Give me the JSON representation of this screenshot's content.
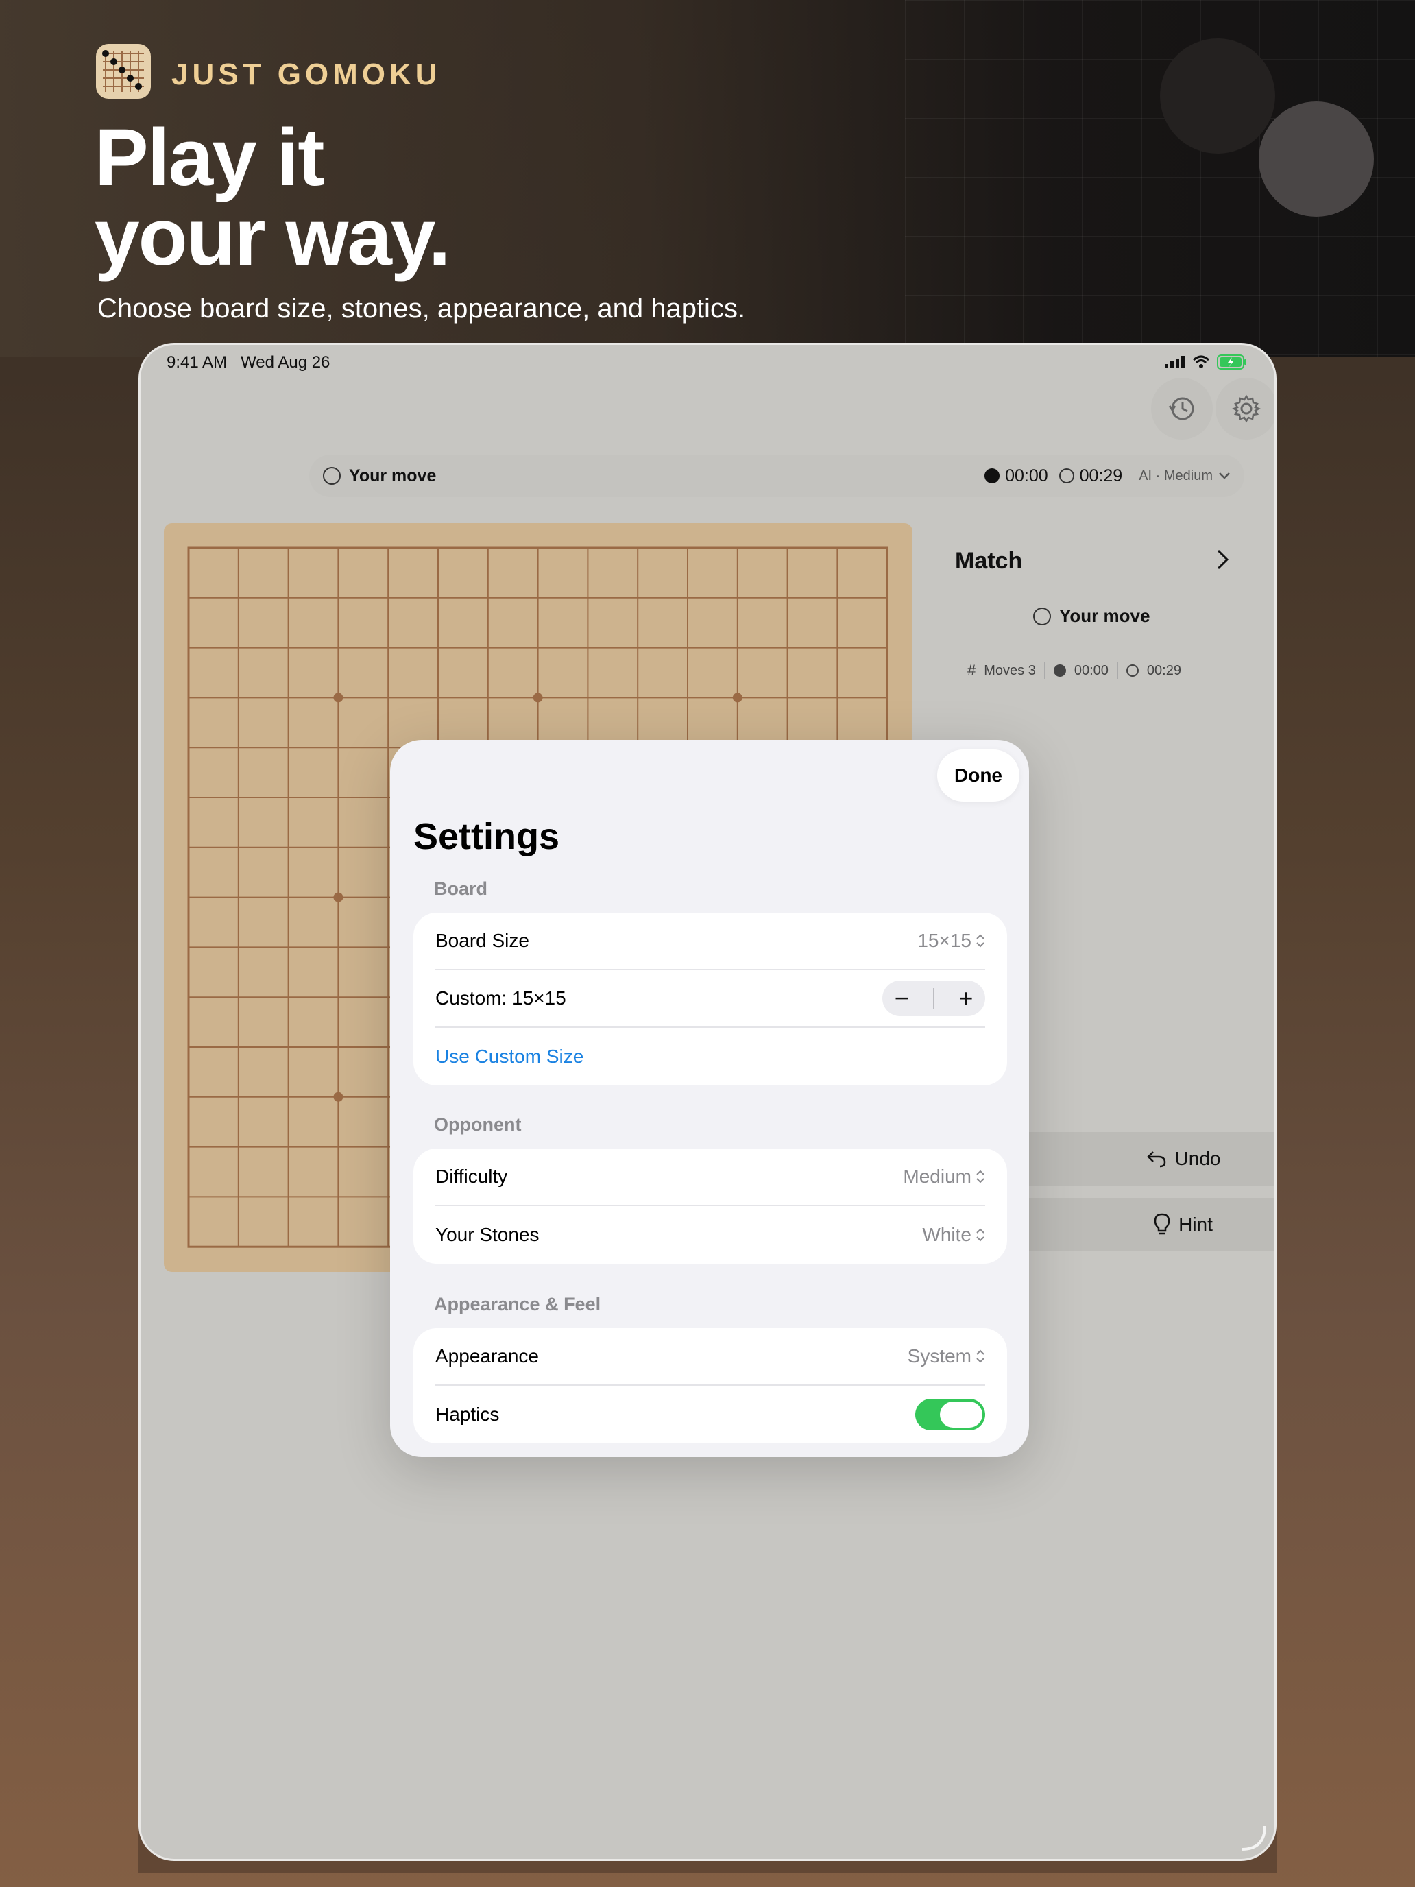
{
  "header": {
    "app_name": "JUST GOMOKU",
    "headline_line1": "Play it",
    "headline_line2": "your way.",
    "subheadline": "Choose board size, stones, appearance, and haptics."
  },
  "status_bar": {
    "time": "9:41 AM",
    "date": "Wed Aug 26"
  },
  "turn_bar": {
    "turn_text": "Your move",
    "black_timer": "00:00",
    "white_timer": "00:29",
    "ai_label": "AI · Medium"
  },
  "match_panel": {
    "title": "Match",
    "turn_text": "Your move",
    "moves_label": "Moves 3",
    "black_timer": "00:00",
    "white_timer": "00:29",
    "undo_label": "Undo",
    "hint_label": "Hint"
  },
  "settings": {
    "done_label": "Done",
    "title": "Settings",
    "board_section": {
      "header": "Board",
      "board_size_label": "Board Size",
      "board_size_value": "15×15",
      "custom_label": "Custom: 15×15",
      "use_custom_label": "Use Custom Size"
    },
    "opponent_section": {
      "header": "Opponent",
      "difficulty_label": "Difficulty",
      "difficulty_value": "Medium",
      "stones_label": "Your Stones",
      "stones_value": "White"
    },
    "appearance_section": {
      "header": "Appearance & Feel",
      "appearance_label": "Appearance",
      "appearance_value": "System",
      "haptics_label": "Haptics",
      "haptics_on": true
    }
  },
  "colors": {
    "accent_link": "#1a82e2",
    "toggle_on": "#34c759",
    "brand_gold": "#efcf95",
    "board_wood": "#cdb38e",
    "board_line": "#9a6a45"
  }
}
